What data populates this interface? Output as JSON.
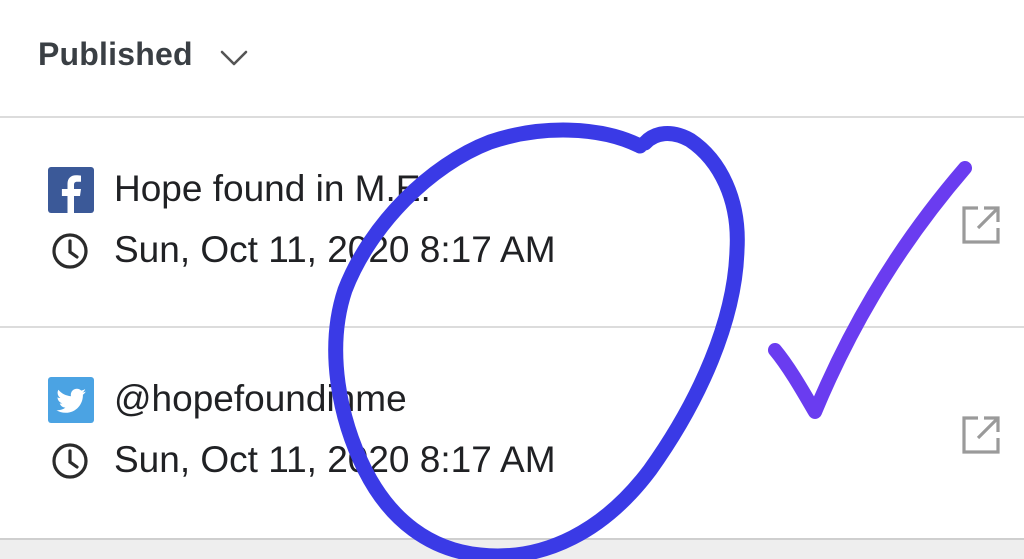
{
  "header": {
    "status_label": "Published"
  },
  "posts": [
    {
      "network": "facebook",
      "account": "Hope found in M.E.",
      "time": "Sun, Oct 11, 2020 8:17 AM"
    },
    {
      "network": "twitter",
      "account": "@hopefoundinme",
      "time": "Sun, Oct 11, 2020 8:17 AM"
    }
  ],
  "icons": {
    "chevron": "chevron-down-icon",
    "facebook": "facebook-icon",
    "twitter": "twitter-icon",
    "clock": "clock-icon",
    "open": "external-link-icon"
  },
  "colors": {
    "facebook": "#3b5998",
    "twitter": "#4ba3e3",
    "annotation_circle": "#3a3ae6",
    "annotation_check": "#6a3cf0"
  }
}
